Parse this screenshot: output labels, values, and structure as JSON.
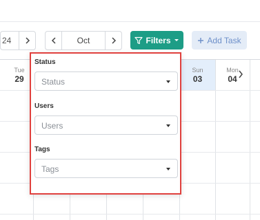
{
  "toolbar": {
    "year_partial": "24",
    "month": "Oct",
    "filters_label": "Filters",
    "add_task_label": "Add Task"
  },
  "calendar": {
    "days": [
      {
        "name": "Tue",
        "num": "29"
      },
      {
        "name": "Sun",
        "num": "03"
      },
      {
        "name": "Mon",
        "num": "04"
      }
    ]
  },
  "filters": {
    "status": {
      "label": "Status",
      "placeholder": "Status"
    },
    "users": {
      "label": "Users",
      "placeholder": "Users"
    },
    "tags": {
      "label": "Tags",
      "placeholder": "Tags"
    }
  },
  "colors": {
    "accent": "#1d9d86",
    "add_task_bg": "#e4ecf7",
    "highlight_border": "#e0403d",
    "today_bg": "#e3eefb"
  },
  "icons": [
    "chevron-right-icon",
    "chevron-left-icon",
    "filter-icon",
    "caret-down-icon",
    "plus-icon"
  ]
}
